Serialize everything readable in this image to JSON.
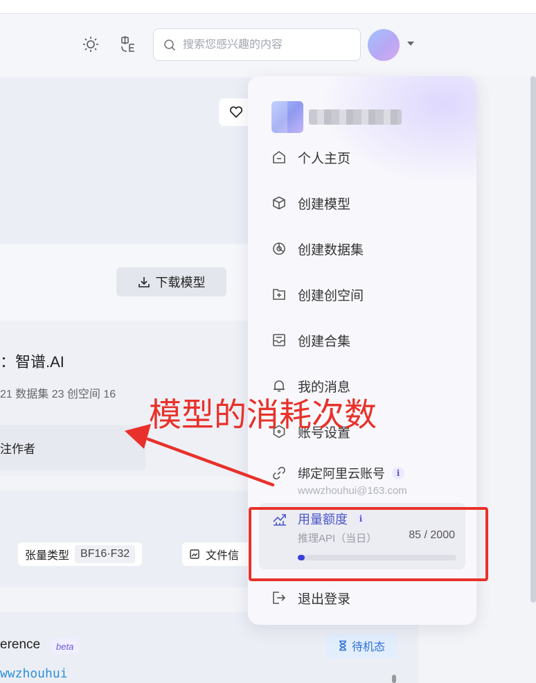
{
  "header": {
    "search_placeholder": "搜索您感兴趣的内容",
    "theme_icon": "sun-icon",
    "language_icon": "language-switch-icon"
  },
  "page": {
    "download_button": "下载模型",
    "org_name": "：智谱.AI",
    "org_stats": "21 数据集 23 创空间 16",
    "follow_text": "注作者",
    "tensor_type_label": "张量类型",
    "tensor_type_value": "BF16·F32",
    "file_info_label": "文件信",
    "inference_label": "erence",
    "beta_badge": "beta",
    "standby_label": "待机态",
    "username_text": "wwzhouhui"
  },
  "dropdown": {
    "menu": [
      {
        "label": "个人主页",
        "icon": "home-icon"
      },
      {
        "label": "创建模型",
        "icon": "cube-icon"
      },
      {
        "label": "创建数据集",
        "icon": "pie-chart-icon"
      },
      {
        "label": "创建创空间",
        "icon": "folder-plus-icon"
      },
      {
        "label": "创建合集",
        "icon": "inbox-icon"
      },
      {
        "label": "我的消息",
        "icon": "bell-icon"
      },
      {
        "label": "账号设置",
        "icon": "settings-hexagon-icon"
      },
      {
        "label": "绑定阿里云账号",
        "icon": "link-icon"
      }
    ],
    "bound_email": "wwwzhouhui@163.com",
    "info_glyph": "i",
    "usage": {
      "title": "用量额度",
      "label": "推理API（当日）",
      "count": "85 / 2000",
      "used": 85,
      "limit": 2000
    },
    "logout": "退出登录"
  },
  "annotation": {
    "text": "模型的消耗次数",
    "color": "#e8312a"
  }
}
